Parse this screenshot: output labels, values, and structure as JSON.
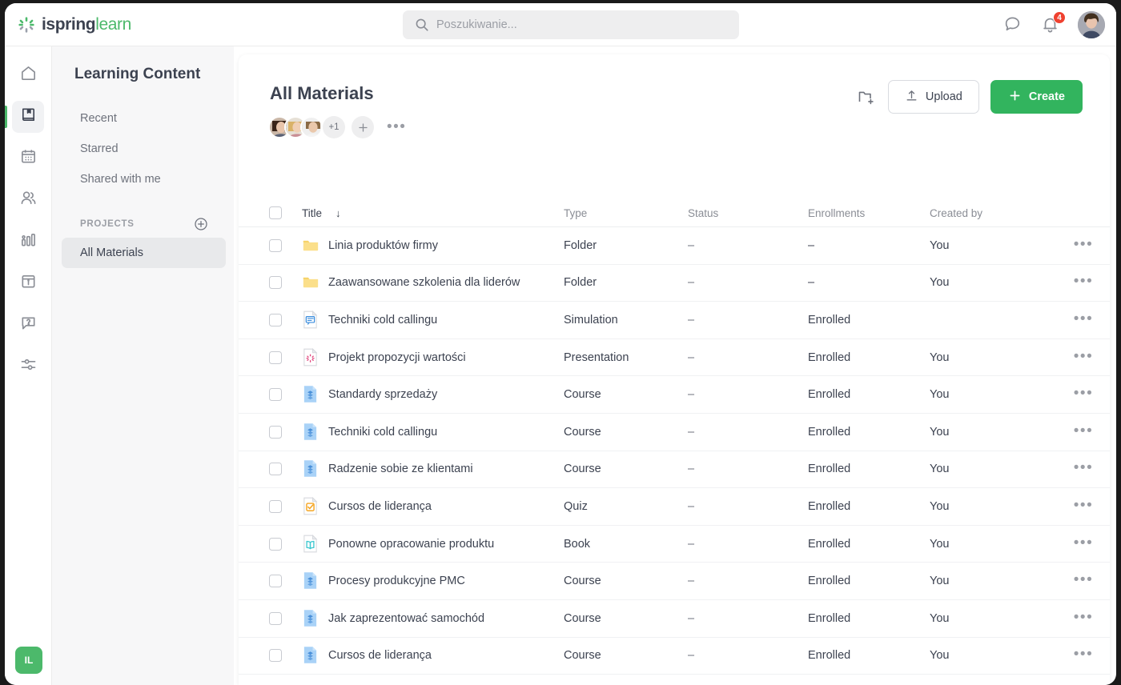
{
  "brand": {
    "name_dark": "ispring",
    "name_green": "learn",
    "accent": "#4cb96b"
  },
  "topbar": {
    "search": {
      "placeholder": "Poszukiwanie...",
      "value": ""
    },
    "chat_icon": "chat-bubble-icon",
    "notifications_icon": "bell-icon",
    "notifications_count": "4",
    "avatar": "user-avatar"
  },
  "rail": {
    "items": [
      {
        "name": "home",
        "icon": "home-icon",
        "active": false
      },
      {
        "name": "learning-content",
        "icon": "book-icon",
        "active": true
      },
      {
        "name": "calendar",
        "icon": "calendar-icon",
        "active": false
      },
      {
        "name": "users",
        "icon": "people-icon",
        "active": false
      },
      {
        "name": "reports",
        "icon": "bar-chart-icon",
        "active": false
      },
      {
        "name": "news",
        "icon": "newspaper-icon",
        "active": false
      },
      {
        "name": "help",
        "icon": "question-chat-icon",
        "active": false
      },
      {
        "name": "settings",
        "icon": "sliders-icon",
        "active": false
      }
    ],
    "account_badge": "IL"
  },
  "sidebar": {
    "title": "Learning Content",
    "items": [
      {
        "label": "Recent",
        "selected": false
      },
      {
        "label": "Starred",
        "selected": false
      },
      {
        "label": "Shared with me",
        "selected": false
      }
    ],
    "section_label": "PROJECTS",
    "section_add_icon": "plus-circle-icon",
    "projects": [
      {
        "label": "All Materials",
        "selected": true
      }
    ]
  },
  "main": {
    "title": "All Materials",
    "collaborators": {
      "extra_count": "+1",
      "add_icon": "plus-icon",
      "more_icon": "ellipsis-icon"
    },
    "toolbar": {
      "new_folder_icon": "new-folder-icon",
      "upload_label": "Upload",
      "upload_icon": "upload-icon",
      "create_label": "Create",
      "create_icon": "plus-icon"
    },
    "table": {
      "columns": [
        "Title",
        "Type",
        "Status",
        "Enrollments",
        "Created by"
      ],
      "sort_column": "Title",
      "sort_direction": "desc",
      "sort_icon": "arrow-down-icon",
      "rows": [
        {
          "icon": "folder-icon",
          "title": "Linia produktów firmy",
          "type": "Folder",
          "status": "–",
          "enrollments": "–",
          "created_by": "You"
        },
        {
          "icon": "folder-icon",
          "title": "Zaawansowane szkolenia dla liderów",
          "type": "Folder",
          "status": "–",
          "enrollments": "–",
          "created_by": "You"
        },
        {
          "icon": "simulation-icon",
          "title": "Techniki cold callingu",
          "type": "Simulation",
          "status": "–",
          "enrollments": "Enrolled",
          "created_by": ""
        },
        {
          "icon": "presentation-icon",
          "title": "Projekt propozycji wartości",
          "type": "Presentation",
          "status": "–",
          "enrollments": "Enrolled",
          "created_by": "You"
        },
        {
          "icon": "course-icon",
          "title": "Standardy sprzedaży",
          "type": "Course",
          "status": "–",
          "enrollments": "Enrolled",
          "created_by": "You"
        },
        {
          "icon": "course-icon",
          "title": "Techniki cold callingu",
          "type": "Course",
          "status": "–",
          "enrollments": "Enrolled",
          "created_by": "You"
        },
        {
          "icon": "course-icon",
          "title": "Radzenie sobie ze klientami",
          "type": "Course",
          "status": "–",
          "enrollments": "Enrolled",
          "created_by": "You"
        },
        {
          "icon": "quiz-icon",
          "title": "Cursos de liderança",
          "type": "Quiz",
          "status": "–",
          "enrollments": "Enrolled",
          "created_by": "You"
        },
        {
          "icon": "book-file-icon",
          "title": "Ponowne opracowanie produktu",
          "type": "Book",
          "status": "–",
          "enrollments": "Enrolled",
          "created_by": "You"
        },
        {
          "icon": "course-icon",
          "title": "Procesy produkcyjne PMC",
          "type": "Course",
          "status": "–",
          "enrollments": "Enrolled",
          "created_by": "You"
        },
        {
          "icon": "course-icon",
          "title": "Jak zaprezentować samochód",
          "type": "Course",
          "status": "–",
          "enrollments": "Enrolled",
          "created_by": "You"
        },
        {
          "icon": "course-icon",
          "title": "Cursos de liderança",
          "type": "Course",
          "status": "–",
          "enrollments": "Enrolled",
          "created_by": "You"
        }
      ],
      "row_menu_icon": "ellipsis-icon"
    }
  },
  "colors": {
    "accent_green": "#32b45e",
    "badge_red": "#ef4130",
    "folder_yellow": "#fbdf8a",
    "course_blue": "#a9d2f7",
    "quiz_orange": "#f5a623",
    "book_teal": "#3fc8d0",
    "presentation_pink": "#e0447c"
  }
}
